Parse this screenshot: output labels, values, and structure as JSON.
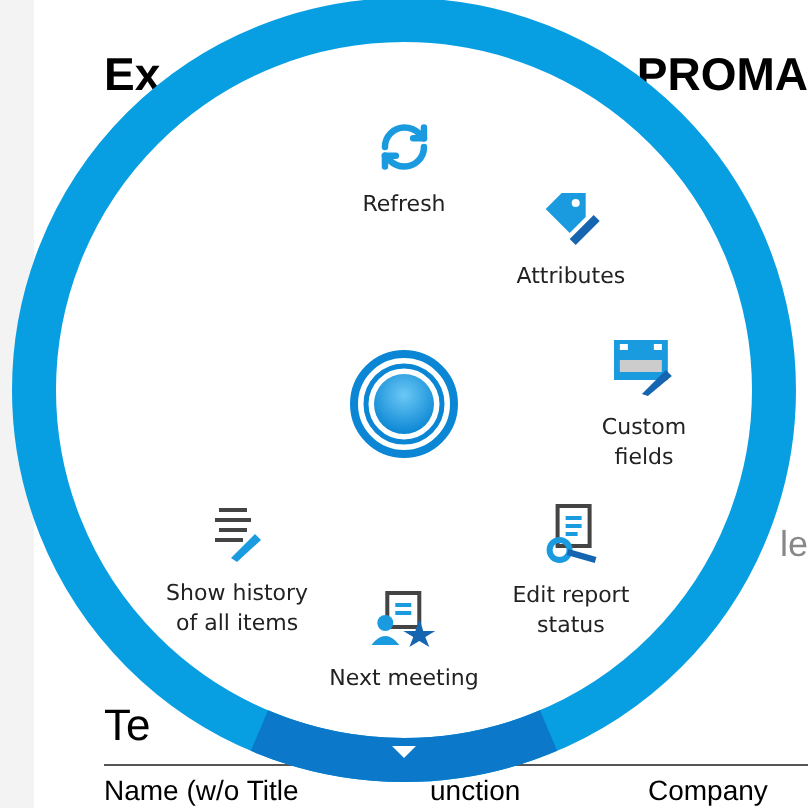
{
  "page": {
    "title_start": "Ex",
    "title_end": "PROMA",
    "side_text": "le",
    "heading": "Te",
    "columns": [
      "Name (w/o Title",
      "unction",
      "Company"
    ]
  },
  "radial_menu": {
    "items": [
      {
        "label": "Refresh",
        "kind": "refresh"
      },
      {
        "label": "Attributes",
        "kind": "tag"
      },
      {
        "label": "Custom\nfields",
        "kind": "fields"
      },
      {
        "label": "Edit report\nstatus",
        "kind": "report"
      },
      {
        "label": "Next meeting",
        "kind": "meeting"
      },
      {
        "label": "Show history\nof all items",
        "kind": "history"
      }
    ]
  }
}
